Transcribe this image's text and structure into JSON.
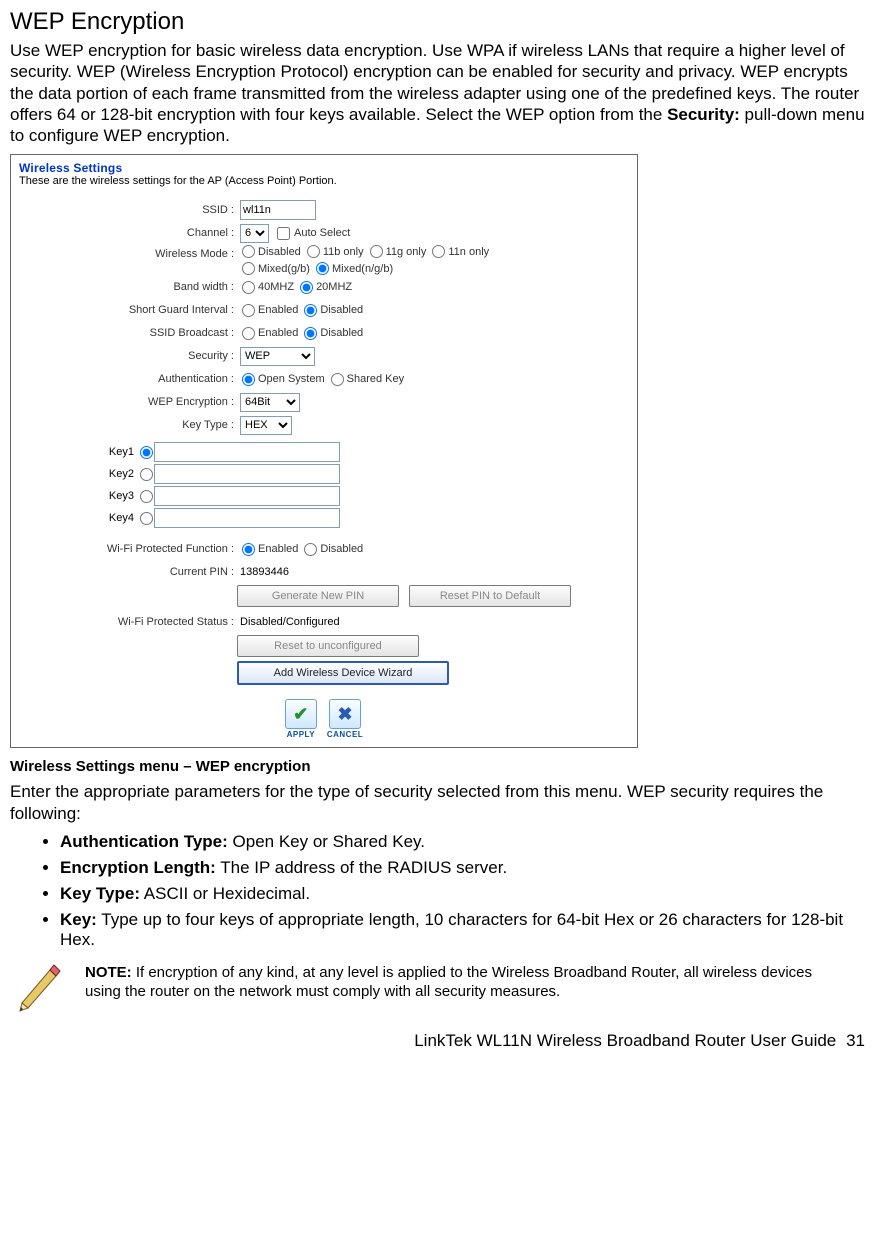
{
  "heading": "WEP Encryption",
  "intro_a": "Use WEP encryption for basic wireless data encryption. Use WPA if wireless LANs that require a higher level of security. WEP (Wireless Encryption Protocol) encryption can be enabled for security and privacy. WEP encrypts the data portion of each frame transmitted from the wireless adapter using one of the predefined keys. The router offers 64 or 128-bit encryption with four keys available. Select the WEP option from the ",
  "intro_bold": "Security:",
  "intro_b": " pull-down menu to configure WEP encryption.",
  "panel": {
    "title": "Wireless Settings",
    "subtitle": "These are the wireless settings for the AP (Access Point) Portion.",
    "fields": {
      "ssid_label": "SSID :",
      "ssid_value": "wl11n",
      "channel_label": "Channel :",
      "channel_value": "6",
      "auto_select": "Auto Select",
      "wmode_label": "Wireless Mode :",
      "wmode_opts": [
        "Disabled",
        "11b only",
        "11g only",
        "11n only",
        "Mixed(g/b)",
        "Mixed(n/g/b)"
      ],
      "bw_label": "Band width :",
      "bw_opts": [
        "40MHZ",
        "20MHZ"
      ],
      "sgi_label": "Short Guard Interval :",
      "sgi_opts": [
        "Enabled",
        "Disabled"
      ],
      "ssidb_label": "SSID Broadcast :",
      "ssidb_opts": [
        "Enabled",
        "Disabled"
      ],
      "sec_label": "Security :",
      "sec_value": "WEP",
      "auth_label": "Authentication :",
      "auth_opts": [
        "Open System",
        "Shared Key"
      ],
      "wepenc_label": "WEP Encryption :",
      "wepenc_value": "64Bit",
      "keytype_label": "Key Type :",
      "keytype_value": "HEX",
      "keys": [
        "Key1",
        "Key2",
        "Key3",
        "Key4"
      ],
      "wpf_label": "Wi-Fi Protected Function :",
      "wpf_opts": [
        "Enabled",
        "Disabled"
      ],
      "pin_label": "Current PIN :",
      "pin_value": "13893446",
      "btn_gen": "Generate New PIN",
      "btn_reset": "Reset PIN to Default",
      "wps_status_label": "Wi-Fi Protected Status :",
      "wps_status_value": "Disabled/Configured",
      "btn_unconf": "Reset to unconfigured",
      "btn_wizard": "Add Wireless Device Wizard",
      "apply": "APPLY",
      "cancel": "CANCEL"
    }
  },
  "caption": "Wireless Settings menu – WEP encryption",
  "para2": "Enter the appropriate parameters for the type of security selected from this menu. WEP security requires the following:",
  "bullets": [
    {
      "b": "Authentication Type:",
      "t": " Open Key or Shared Key."
    },
    {
      "b": "Encryption Length:",
      "t": " The IP address of the RADIUS server."
    },
    {
      "b": "Key Type:",
      "t": " ASCII or Hexidecimal."
    },
    {
      "b": "Key:",
      "t": " Type up to four keys of appropriate length, 10 characters for 64-bit Hex or 26 characters for 128-bit Hex."
    }
  ],
  "note_b": "NOTE:",
  "note_t": " If encryption of any kind, at any level is applied to the Wireless Broadband Router, all wireless devices using the router on the network must comply with all security measures.",
  "footer": "LinkTek WL11N Wireless Broadband Router User Guide",
  "page": "31"
}
